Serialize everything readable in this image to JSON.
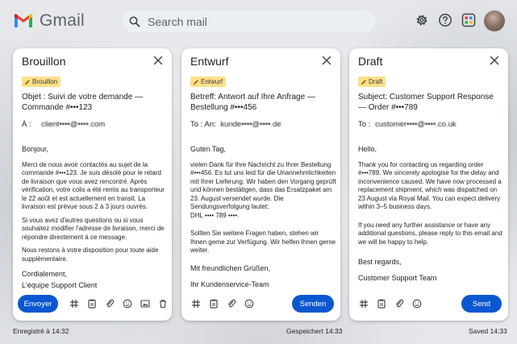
{
  "app": {
    "name": "Gmail"
  },
  "search": {
    "placeholder": "Search mail"
  },
  "header_icons": [
    "settings-icon",
    "help-icon",
    "apps-icon",
    "avatar"
  ],
  "colors": {
    "send_button": "#0b57d0",
    "draft_badge": "#fde08a",
    "background": "#e9ebee"
  },
  "drafts": [
    {
      "title": "Brouillon",
      "badge": "Brouillon",
      "subject": "Objet : Suivi de votre demande — Commande #•••123",
      "to_label": "À :",
      "to_value": "client••••@••••.com",
      "greeting": "Bonjour,",
      "paragraphs": [
        "Merci de nous avoir contactés au sujet de la commande #•••123. Je suis désolé pour le retard de livraison que vous avez rencontré. Après vérification, votre colis a été remis au transporteur le 22 août et est actuellement en transit. La livraison est prévue sous 2 à 3 jours ouvrés.",
        "Si vous avez d'autres questions ou si vous souhaitez modifier l'adresse de livraison, merci de répondre directement à ce message.",
        "Nous restons à votre disposition pour toute aide supplémentaire."
      ],
      "closing": "Cordialement,",
      "signature": "L'équipe Support Client",
      "send_label": "Envoyer",
      "status": "Enregistré à 14:32"
    },
    {
      "title": "Entwurf",
      "badge": "Entwurf",
      "subject": "Betreff: Antwort auf Ihre Anfrage — Bestellung #•••456",
      "to_label": "To : An:",
      "to_value": "kunde••••@••••.de",
      "greeting": "Guten Tag,",
      "paragraphs": [
        "vielen Dank für Ihre Nachricht zu Ihrer Bestellung #•••456. Es tut uns leid für die Unannehmlichkeiten mit Ihrer Lieferung. Wir haben den Vorgang geprüft und können bestätigen, dass das Ersatzpaket am 23. August versendet wurde. Die Sendungsverfolgung lautet:",
        "DHL •••• 789 ••••.",
        "Sollten Sie weitere Fragen haben, stehen wir Ihnen gerne zur Verfügung. Wir helfen Ihnen gerne weiter."
      ],
      "closing": "Mit freundlichen Grüßen,",
      "signature": "Ihr Kundenservice-Team",
      "send_label": "Senden",
      "status": "Gespeichert 14:33"
    },
    {
      "title": "Draft",
      "badge": "Draft",
      "subject": "Subject: Customer Support Response — Order #•••789",
      "to_label": "To :",
      "to_value": "customer••••@••••.co.uk",
      "greeting": "Hello,",
      "paragraphs": [
        "Thank you for contacting us regarding order #•••789. We sincerely apologise for the delay and inconvenience caused. We have now processed a replacement shipment, which was dispatched on 23 August via Royal Mail. You can expect delivery within 3–5 business days.",
        "If you need any further assistance or have any additional questions, please reply to this email and we will be happy to help."
      ],
      "closing": "Best regards,",
      "signature": "Customer Support Team",
      "send_label": "Send",
      "status": "Saved 14:33"
    }
  ]
}
